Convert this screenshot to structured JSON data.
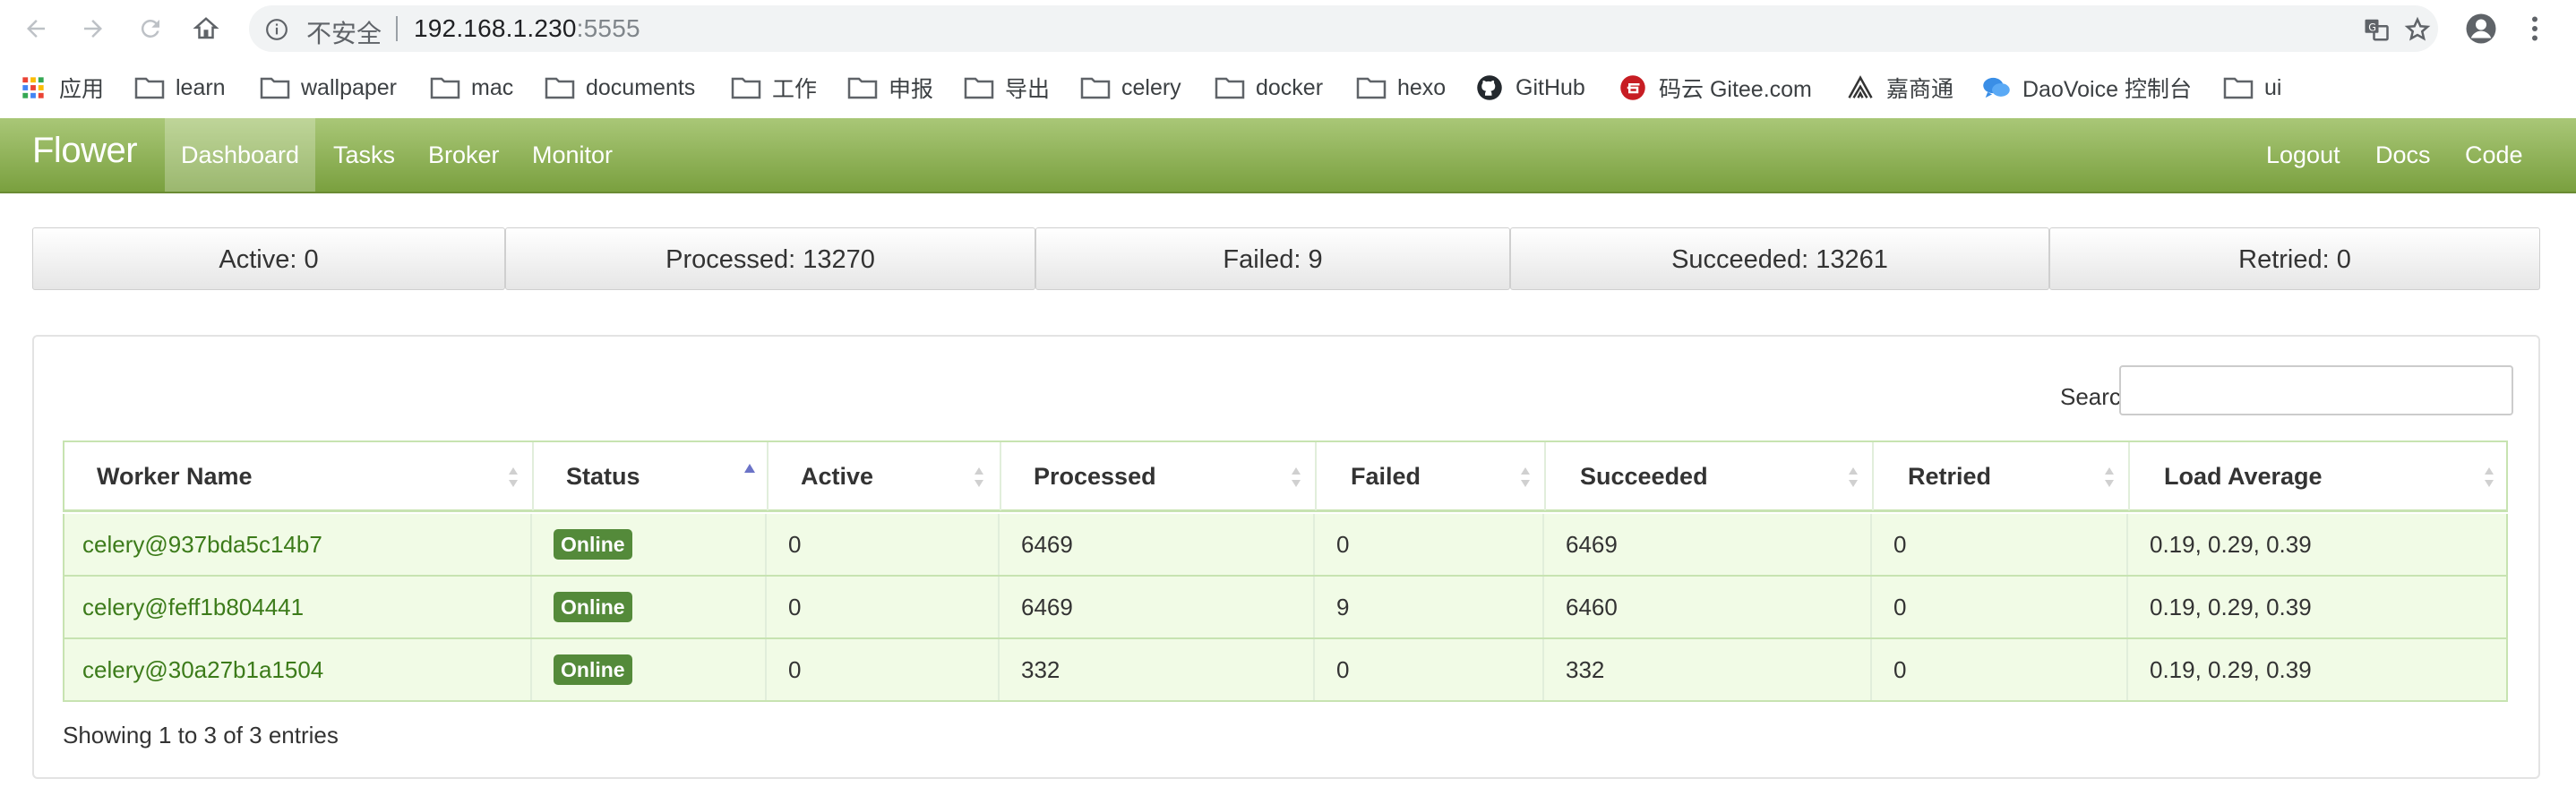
{
  "browser": {
    "insecure_label": "不安全",
    "url_host": "192.168.1.230",
    "url_port": ":5555"
  },
  "bookmarks": [
    "应用",
    "learn",
    "wallpaper",
    "mac",
    "documents",
    "工作",
    "申报",
    "导出",
    "celery",
    "docker",
    "hexo",
    "GitHub",
    "码云 Gitee.com",
    "嘉商通",
    "DaoVoice 控制台",
    "ui"
  ],
  "navbar": {
    "brand": "Flower",
    "items": [
      "Dashboard",
      "Tasks",
      "Broker",
      "Monitor"
    ],
    "active": "Dashboard",
    "right_items": [
      "Logout",
      "Docs",
      "Code"
    ]
  },
  "stats": [
    "Active: 0",
    "Processed: 13270",
    "Failed: 9",
    "Succeeded: 13261",
    "Retried: 0"
  ],
  "search": {
    "label": "Search:",
    "value": ""
  },
  "table": {
    "columns": [
      "Worker Name",
      "Status",
      "Active",
      "Processed",
      "Failed",
      "Succeeded",
      "Retried",
      "Load Average"
    ],
    "rows": [
      [
        "celery@937bda5c14b7",
        "Online",
        "0",
        "6469",
        "0",
        "6469",
        "0",
        "0.19, 0.29, 0.39"
      ],
      [
        "celery@feff1b804441",
        "Online",
        "0",
        "6469",
        "9",
        "6460",
        "0",
        "0.19, 0.29, 0.39"
      ],
      [
        "celery@30a27b1a1504",
        "Online",
        "0",
        "332",
        "0",
        "332",
        "0",
        "0.19, 0.29, 0.39"
      ]
    ]
  },
  "info": "Showing 1 to 3 of 3 entries",
  "colors": {
    "nav_top": "#a9c777",
    "nav_bottom": "#7aa03f",
    "badge": "#548a3a",
    "row_bg": "#f1fbe6",
    "link": "#3c7b1a"
  }
}
